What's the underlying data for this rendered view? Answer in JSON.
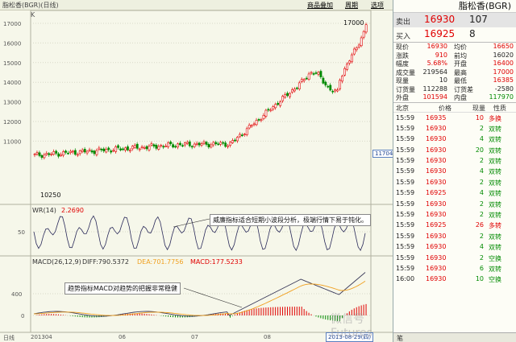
{
  "topbar": {
    "title": "脂松香(BGR)(日线)",
    "btn_overlay": "商品叠加",
    "btn_notes": "周期",
    "btn_options": "选项"
  },
  "price_pane": {
    "k_label": "K",
    "y_ticks": [
      "17000",
      "16000",
      "15000",
      "14000",
      "13000",
      "12000",
      "11000"
    ],
    "high_label": "17000",
    "low_label": "10250",
    "cursor_badge": "11704"
  },
  "wr_pane": {
    "label": "WR(14)",
    "value": "2.2690",
    "y_ticks": [
      "50"
    ],
    "annotation": "威廉指标适合短期小波段分析，极端行情下易于钝化。"
  },
  "macd_pane": {
    "label": "MACD(26,12,9)",
    "diff": "DIFF:790.5372",
    "dea": "DEA:701.7756",
    "macd": "MACD:177.5233",
    "y_ticks": [
      "400",
      "0"
    ],
    "annotation": "趋势指标MACD对趋势的把握非常稳健"
  },
  "x_axis": {
    "mode": "日线",
    "ticks": [
      "201304",
      "06",
      "07",
      "08"
    ],
    "date_badge": "2013-08-29(四)"
  },
  "watermark": "微信号 Futures",
  "quote": {
    "title": "脂松香(BGR)",
    "sell": {
      "label": "卖出",
      "price": "16930",
      "volume": "107"
    },
    "buy": {
      "label": "买入",
      "price": "16925",
      "volume": "8"
    },
    "stats": [
      {
        "l1": "现价",
        "v1": "16930",
        "c1": "red",
        "l2": "均价",
        "v2": "16650",
        "c2": "red"
      },
      {
        "l1": "涨跌",
        "v1": "910",
        "c1": "red",
        "l2": "前均",
        "v2": "16020",
        "c2": "blk"
      },
      {
        "l1": "幅度",
        "v1": "5.68%",
        "c1": "red",
        "l2": "开盘",
        "v2": "16400",
        "c2": "red"
      },
      {
        "l1": "成交量",
        "v1": "219564",
        "c1": "blk",
        "l2": "最高",
        "v2": "17000",
        "c2": "red"
      },
      {
        "l1": "现量",
        "v1": "10",
        "c1": "blk",
        "l2": "最低",
        "v2": "16385",
        "c2": "red"
      },
      {
        "l1": "订货量",
        "v1": "112288",
        "c1": "blk",
        "l2": "订货差",
        "v2": "-2580",
        "c2": "blk"
      },
      {
        "l1": "外盘",
        "v1": "101594",
        "c1": "red",
        "l2": "内盘",
        "v2": "117970",
        "c2": "grn"
      }
    ],
    "ticks_header": {
      "place": "北京",
      "price": "价格",
      "volume": "现量",
      "nature": "性质"
    },
    "ticks": [
      {
        "time": "15:59",
        "price": "16935",
        "volume": "10",
        "nature": "多换",
        "color": "red"
      },
      {
        "time": "15:59",
        "price": "16930",
        "volume": "2",
        "nature": "双转",
        "color": "grn"
      },
      {
        "time": "15:59",
        "price": "16930",
        "volume": "4",
        "nature": "双转",
        "color": "grn"
      },
      {
        "time": "15:59",
        "price": "16930",
        "volume": "20",
        "nature": "双转",
        "color": "grn"
      },
      {
        "time": "15:59",
        "price": "16930",
        "volume": "2",
        "nature": "双转",
        "color": "grn"
      },
      {
        "time": "15:59",
        "price": "16930",
        "volume": "4",
        "nature": "双转",
        "color": "grn"
      },
      {
        "time": "15:59",
        "price": "16930",
        "volume": "2",
        "nature": "双转",
        "color": "grn"
      },
      {
        "time": "15:59",
        "price": "16925",
        "volume": "4",
        "nature": "双转",
        "color": "grn"
      },
      {
        "time": "15:59",
        "price": "16930",
        "volume": "2",
        "nature": "双转",
        "color": "grn"
      },
      {
        "time": "15:59",
        "price": "16930",
        "volume": "2",
        "nature": "双转",
        "color": "grn"
      },
      {
        "time": "15:59",
        "price": "16925",
        "volume": "26",
        "nature": "多转",
        "color": "red"
      },
      {
        "time": "15:59",
        "price": "16930",
        "volume": "2",
        "nature": "双转",
        "color": "grn"
      },
      {
        "time": "15:59",
        "price": "16930",
        "volume": "4",
        "nature": "双转",
        "color": "grn"
      },
      {
        "time": "15:59",
        "price": "16930",
        "volume": "2",
        "nature": "空换",
        "color": "grn"
      },
      {
        "time": "15:59",
        "price": "16930",
        "volume": "6",
        "nature": "双转",
        "color": "grn"
      },
      {
        "time": "16:00",
        "price": "16930",
        "volume": "10",
        "nature": "空换",
        "color": "grn"
      }
    ],
    "tab_label": "笔"
  },
  "colors": {
    "up": "#e00000",
    "down": "#008a00",
    "ma_dark": "#3a3a5a",
    "ma_orange": "#f0a020"
  }
}
